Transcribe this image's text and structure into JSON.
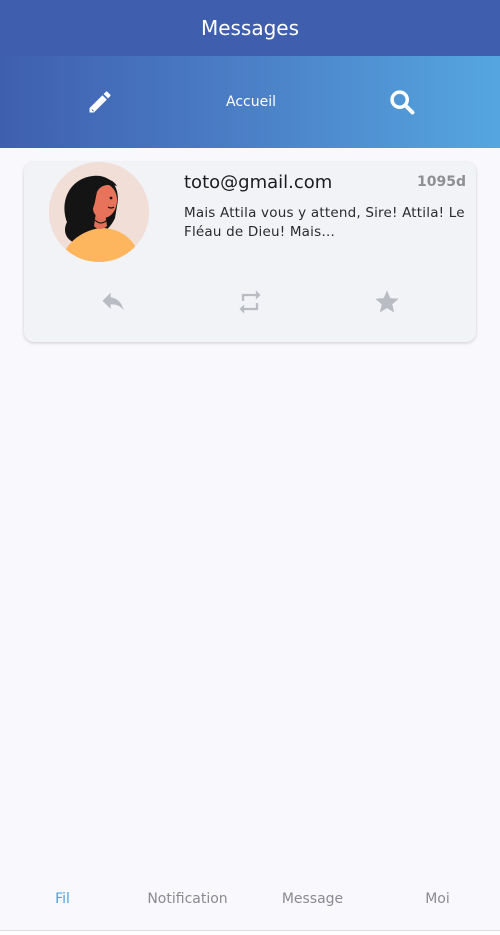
{
  "header": {
    "title": "Messages"
  },
  "toolbar": {
    "compose_icon": "pencil-icon",
    "home_label": "Accueil",
    "search_icon": "search-icon"
  },
  "feed": {
    "posts": [
      {
        "author": "toto@gmail.com",
        "age": "1095d",
        "text": "Mais Attila vous y attend, Sire! Attila! Le Fléau de Dieu! Mais…",
        "actions": [
          "reply-icon",
          "repost-icon",
          "star-icon"
        ]
      }
    ]
  },
  "bottom_nav": {
    "items": [
      {
        "label": "Fil",
        "active": true
      },
      {
        "label": "Notification",
        "active": false
      },
      {
        "label": "Message",
        "active": false
      },
      {
        "label": "Moi",
        "active": false
      }
    ]
  },
  "colors": {
    "header": "#3f5fae",
    "gradient_end": "#55a6e0",
    "active_nav": "#4a9fe0",
    "action_icons": "#b9bcc2"
  }
}
